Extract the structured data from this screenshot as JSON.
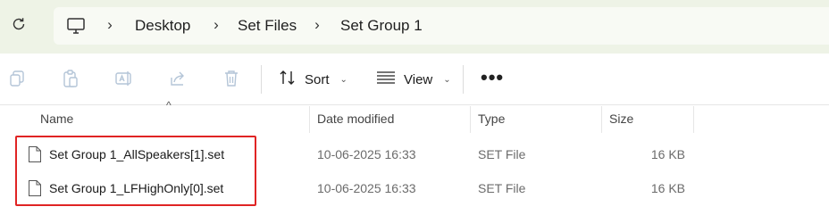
{
  "address": {
    "refresh_icon": "refresh-icon",
    "pc_icon": "computer-icon",
    "breadcrumbs": [
      "Desktop",
      "Set Files",
      "Set Group 1"
    ]
  },
  "toolbar": {
    "icons": [
      "copy-icon",
      "paste-icon",
      "rename-icon",
      "share-icon",
      "delete-icon"
    ],
    "sort_label": "Sort",
    "view_label": "View",
    "more_label": "•••"
  },
  "columns": {
    "name": "Name",
    "date": "Date modified",
    "type": "Type",
    "size": "Size"
  },
  "files": [
    {
      "name": "Set Group 1_AllSpeakers[1].set",
      "date": "10-06-2025 16:33",
      "type": "SET File",
      "size": "16 KB"
    },
    {
      "name": "Set Group 1_LFHighOnly[0].set",
      "date": "10-06-2025 16:33",
      "type": "SET File",
      "size": "16 KB"
    }
  ],
  "highlight_color": "#e02424",
  "accent_bg": "#eef3e6"
}
